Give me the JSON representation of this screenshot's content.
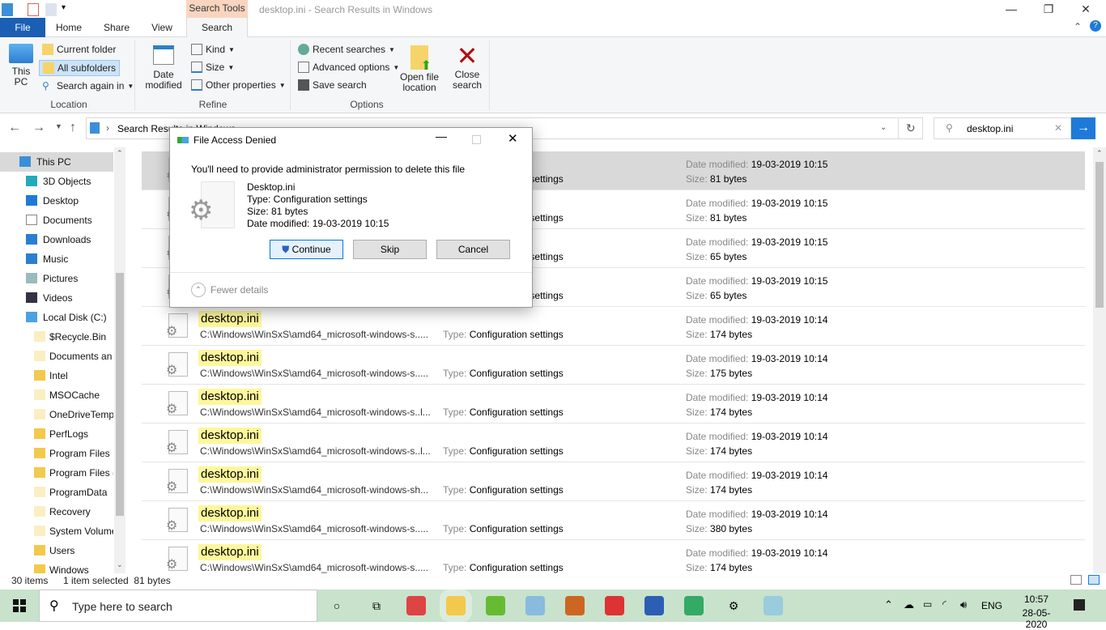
{
  "window": {
    "title": "desktop.ini - Search Results in Windows",
    "context_tab": "Search Tools",
    "controls": {
      "minimize": "—",
      "maximize": "❐",
      "close": "✕"
    }
  },
  "tabs": [
    "File",
    "Home",
    "Share",
    "View",
    "Search"
  ],
  "ribbon": {
    "location": {
      "label": "Location",
      "this_pc": "This PC",
      "current_folder": "Current folder",
      "all_subfolders": "All subfolders",
      "search_again_in": "Search again in"
    },
    "refine": {
      "label": "Refine",
      "date_modified": "Date modified",
      "kind": "Kind",
      "size": "Size",
      "other_properties": "Other properties"
    },
    "options": {
      "label": "Options",
      "recent_searches": "Recent searches",
      "advanced_options": "Advanced options",
      "save_search": "Save search",
      "open_file_location": "Open file location",
      "close_search": "Close search"
    }
  },
  "address": {
    "path": "Search Results in Windows",
    "search_value": "desktop.ini"
  },
  "nav": {
    "items": [
      {
        "label": "This PC",
        "icon": "pc",
        "level": 0,
        "selected": true
      },
      {
        "label": "3D Objects",
        "icon": "cube",
        "level": 1
      },
      {
        "label": "Desktop",
        "icon": "desktop",
        "level": 1
      },
      {
        "label": "Documents",
        "icon": "document",
        "level": 1
      },
      {
        "label": "Downloads",
        "icon": "download",
        "level": 1
      },
      {
        "label": "Music",
        "icon": "music",
        "level": 1
      },
      {
        "label": "Pictures",
        "icon": "picture",
        "level": 1
      },
      {
        "label": "Videos",
        "icon": "video",
        "level": 1
      },
      {
        "label": "Local Disk (C:)",
        "icon": "drive",
        "level": 1
      },
      {
        "label": "$Recycle.Bin",
        "icon": "folder-faded",
        "level": 2
      },
      {
        "label": "Documents an",
        "icon": "folder-link",
        "level": 2
      },
      {
        "label": "Intel",
        "icon": "folder",
        "level": 2
      },
      {
        "label": "MSOCache",
        "icon": "folder-faded",
        "level": 2
      },
      {
        "label": "OneDriveTemp",
        "icon": "folder-faded",
        "level": 2
      },
      {
        "label": "PerfLogs",
        "icon": "folder",
        "level": 2
      },
      {
        "label": "Program Files",
        "icon": "folder",
        "level": 2
      },
      {
        "label": "Program Files (",
        "icon": "folder",
        "level": 2
      },
      {
        "label": "ProgramData",
        "icon": "folder-faded",
        "level": 2
      },
      {
        "label": "Recovery",
        "icon": "folder-faded",
        "level": 2
      },
      {
        "label": "System Volume",
        "icon": "folder-faded",
        "level": 2
      },
      {
        "label": "Users",
        "icon": "folder",
        "level": 2
      },
      {
        "label": "Windows",
        "icon": "folder",
        "level": 2
      }
    ]
  },
  "labels": {
    "type": "Type:",
    "date_modified": "Date modified:",
    "size": "Size:"
  },
  "results": [
    {
      "name": "",
      "path": "",
      "type": "Configuration settings",
      "date": "19-03-2019 10:15",
      "size": "81 bytes",
      "selected": true
    },
    {
      "name": "",
      "path": "",
      "type": "Configuration settings",
      "date": "19-03-2019 10:15",
      "size": "81 bytes"
    },
    {
      "name": "",
      "path": "",
      "type": "Configuration settings",
      "date": "19-03-2019 10:15",
      "size": "65 bytes"
    },
    {
      "name": "",
      "path": "",
      "type": "Configuration settings",
      "date": "19-03-2019 10:15",
      "size": "65 bytes"
    },
    {
      "name": "desktop.ini",
      "path": "C:\\Windows\\WinSxS\\amd64_microsoft-windows-s.....",
      "type": "Configuration settings",
      "date": "19-03-2019 10:14",
      "size": "174 bytes"
    },
    {
      "name": "desktop.ini",
      "path": "C:\\Windows\\WinSxS\\amd64_microsoft-windows-s.....",
      "type": "Configuration settings",
      "date": "19-03-2019 10:14",
      "size": "175 bytes"
    },
    {
      "name": "desktop.ini",
      "path": "C:\\Windows\\WinSxS\\amd64_microsoft-windows-s..l...",
      "type": "Configuration settings",
      "date": "19-03-2019 10:14",
      "size": "174 bytes"
    },
    {
      "name": "desktop.ini",
      "path": "C:\\Windows\\WinSxS\\amd64_microsoft-windows-s..l...",
      "type": "Configuration settings",
      "date": "19-03-2019 10:14",
      "size": "174 bytes"
    },
    {
      "name": "desktop.ini",
      "path": "C:\\Windows\\WinSxS\\amd64_microsoft-windows-sh...",
      "type": "Configuration settings",
      "date": "19-03-2019 10:14",
      "size": "174 bytes"
    },
    {
      "name": "desktop.ini",
      "path": "C:\\Windows\\WinSxS\\amd64_microsoft-windows-s.....",
      "type": "Configuration settings",
      "date": "19-03-2019 10:14",
      "size": "380 bytes"
    },
    {
      "name": "desktop.ini",
      "path": "C:\\Windows\\WinSxS\\amd64_microsoft-windows-s.....",
      "type": "Configuration settings",
      "date": "19-03-2019 10:14",
      "size": "174 bytes"
    }
  ],
  "status": {
    "count": "30 items",
    "selection": "1 item selected  81 bytes"
  },
  "dialog": {
    "title": "File Access Denied",
    "message": "You'll need to provide administrator permission to delete this file",
    "file_name": "Desktop.ini",
    "file_type": "Type: Configuration settings",
    "file_size": "Size: 81 bytes",
    "file_date": "Date modified: 19-03-2019 10:15",
    "continue": "Continue",
    "skip": "Skip",
    "cancel": "Cancel",
    "fewer_details": "Fewer details"
  },
  "taskbar": {
    "search_placeholder": "Type here to search",
    "apps": [
      "cortana",
      "task-view",
      "chrome",
      "file-explorer",
      "utorrent",
      "notepad",
      "app-orange",
      "popcorn",
      "word",
      "chrome-profile",
      "settings",
      "paint"
    ],
    "language": "ENG",
    "time": "10:57",
    "date": "28-05-2020",
    "color": "#c8e2cc"
  },
  "colors": {
    "accent": "#1a5fb4",
    "highlight": "#fdf79b",
    "context_tab": "#f9d5bf"
  }
}
